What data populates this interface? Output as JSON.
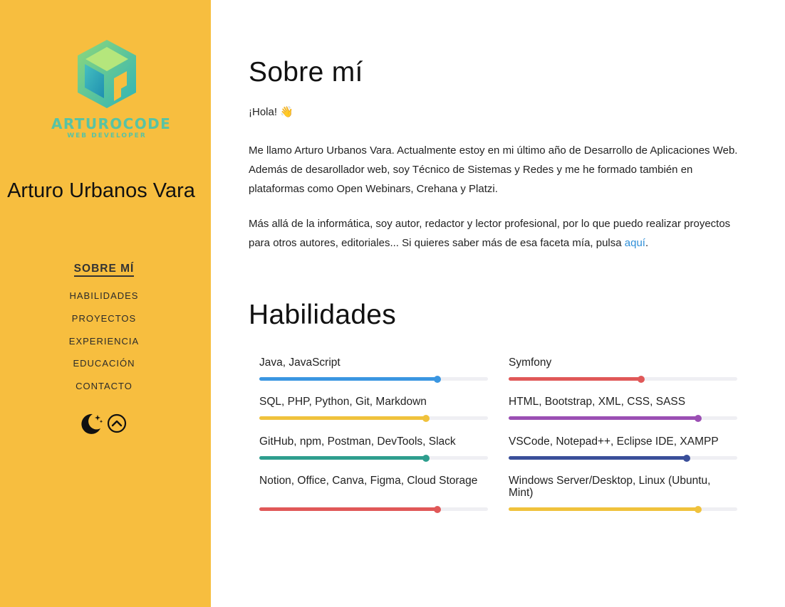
{
  "sidebar": {
    "logo_text": "ARTUROCODE",
    "logo_subtext": "WEB DEVELOPER",
    "name": "Arturo Urbanos Vara",
    "nav": [
      {
        "label": "SOBRE MÍ",
        "active": true
      },
      {
        "label": "HABILIDADES",
        "active": false
      },
      {
        "label": "PROYECTOS",
        "active": false
      },
      {
        "label": "EXPERIENCIA",
        "active": false
      },
      {
        "label": "EDUCACIÓN",
        "active": false
      },
      {
        "label": "CONTACTO",
        "active": false
      }
    ],
    "icons": [
      "moon-stars-icon",
      "chevron-up-circle-icon"
    ]
  },
  "about": {
    "title": "Sobre mí",
    "greeting": "¡Hola! 👋",
    "paragraph1": "Me llamo Arturo Urbanos Vara. Actualmente estoy en mi último año de Desarrollo de Aplicaciones Web. Además de desarollador web, soy Técnico de Sistemas y Redes y me he formado también en plataformas como Open Webinars, Crehana y Platzi.",
    "paragraph2_text": "Más allá de la informática, soy autor, redactor y lector profesional, por lo que puedo realizar proyectos para otros autores, editoriales... Si quieres saber más de esa faceta mía, pulsa ",
    "paragraph2_link": "aquí",
    "paragraph2_end": "."
  },
  "skills": {
    "title": "Habilidades",
    "items": [
      {
        "label": "Java, JavaScript",
        "level": 0.78,
        "color": "#3a96e1"
      },
      {
        "label": "Symfony",
        "level": 0.58,
        "color": "#e05858"
      },
      {
        "label": "SQL, PHP, Python, Git, Markdown",
        "level": 0.73,
        "color": "#f0c23c"
      },
      {
        "label": "HTML, Bootstrap, XML, CSS, SASS",
        "level": 0.83,
        "color": "#9b4fb4"
      },
      {
        "label": "GitHub, npm, Postman, DevTools, Slack",
        "level": 0.73,
        "color": "#2e9e8e"
      },
      {
        "label": "VSCode, Notepad++, Eclipse IDE, XAMPP",
        "level": 0.78,
        "color": "#3a4f9a"
      },
      {
        "label": "Notion, Office, Canva, Figma, Cloud Storage",
        "level": 0.78,
        "color": "#e05858"
      },
      {
        "label": "Windows Server/Desktop, Linux (Ubuntu, Mint)",
        "level": 0.83,
        "color": "#f0c23c"
      }
    ]
  }
}
